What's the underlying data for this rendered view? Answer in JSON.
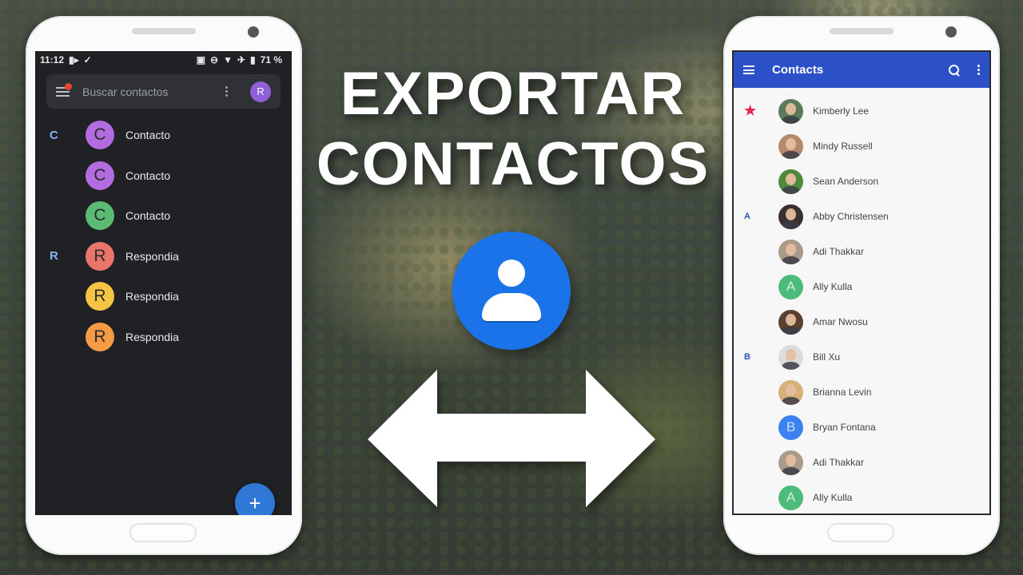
{
  "headline": {
    "line1": "EXPORTAR",
    "line2": "CONTACTOS"
  },
  "left_phone": {
    "status_bar": {
      "time": "11:12",
      "battery": "71 %",
      "icons": [
        "video-camera-icon",
        "check-icon",
        "cast-icon",
        "do-not-disturb-icon",
        "wifi-icon",
        "airplane-icon",
        "battery-icon"
      ]
    },
    "search": {
      "placeholder": "Buscar contactos",
      "account_initial": "R",
      "account_color": "#8e5fd6"
    },
    "contacts": [
      {
        "section": "C",
        "initial": "C",
        "name": "Contacto",
        "color": "#b36be0"
      },
      {
        "section": "",
        "initial": "C",
        "name": "Contacto",
        "color": "#b36be0"
      },
      {
        "section": "",
        "initial": "C",
        "name": "Contacto",
        "color": "#5bbb75"
      },
      {
        "section": "R",
        "initial": "R",
        "name": "Respondia",
        "color": "#e8746a"
      },
      {
        "section": "",
        "initial": "R",
        "name": "Respondia",
        "color": "#f6c443"
      },
      {
        "section": "",
        "initial": "R",
        "name": "Respondia",
        "color": "#f59a45"
      }
    ],
    "fab_label": "+"
  },
  "right_phone": {
    "app_bar": {
      "title": "Contacts",
      "color": "#2b50c8"
    },
    "contacts": [
      {
        "section": "★",
        "name": "Kimberly Lee",
        "avatar": "photo",
        "color": "#5a7a5a"
      },
      {
        "section": "",
        "name": "Mindy Russell",
        "avatar": "photo",
        "color": "#b58a6a"
      },
      {
        "section": "",
        "name": "Sean Anderson",
        "avatar": "photo",
        "color": "#4f8a3c"
      },
      {
        "section": "A",
        "name": "Abby Christensen",
        "avatar": "photo",
        "color": "#3a3030"
      },
      {
        "section": "",
        "name": "Adi Thakkar",
        "avatar": "photo",
        "color": "#a99a8a"
      },
      {
        "section": "",
        "name": "Ally Kulla",
        "avatar": "A",
        "color": "#4dbb7a"
      },
      {
        "section": "",
        "name": "Amar Nwosu",
        "avatar": "photo",
        "color": "#5a4030"
      },
      {
        "section": "B",
        "name": "Bill Xu",
        "avatar": "photo",
        "color": "#dcdcdc"
      },
      {
        "section": "",
        "name": "Brianna Levin",
        "avatar": "photo",
        "color": "#d6b07a"
      },
      {
        "section": "",
        "name": "Bryan Fontana",
        "avatar": "B",
        "color": "#3b82f0"
      },
      {
        "section": "",
        "name": "Adi Thakkar",
        "avatar": "photo",
        "color": "#a99a8a"
      },
      {
        "section": "",
        "name": "Ally Kulla",
        "avatar": "A",
        "color": "#4dbb7a"
      }
    ]
  },
  "center": {
    "logo": "google-contacts-icon",
    "arrow": "double-arrow-icon"
  }
}
